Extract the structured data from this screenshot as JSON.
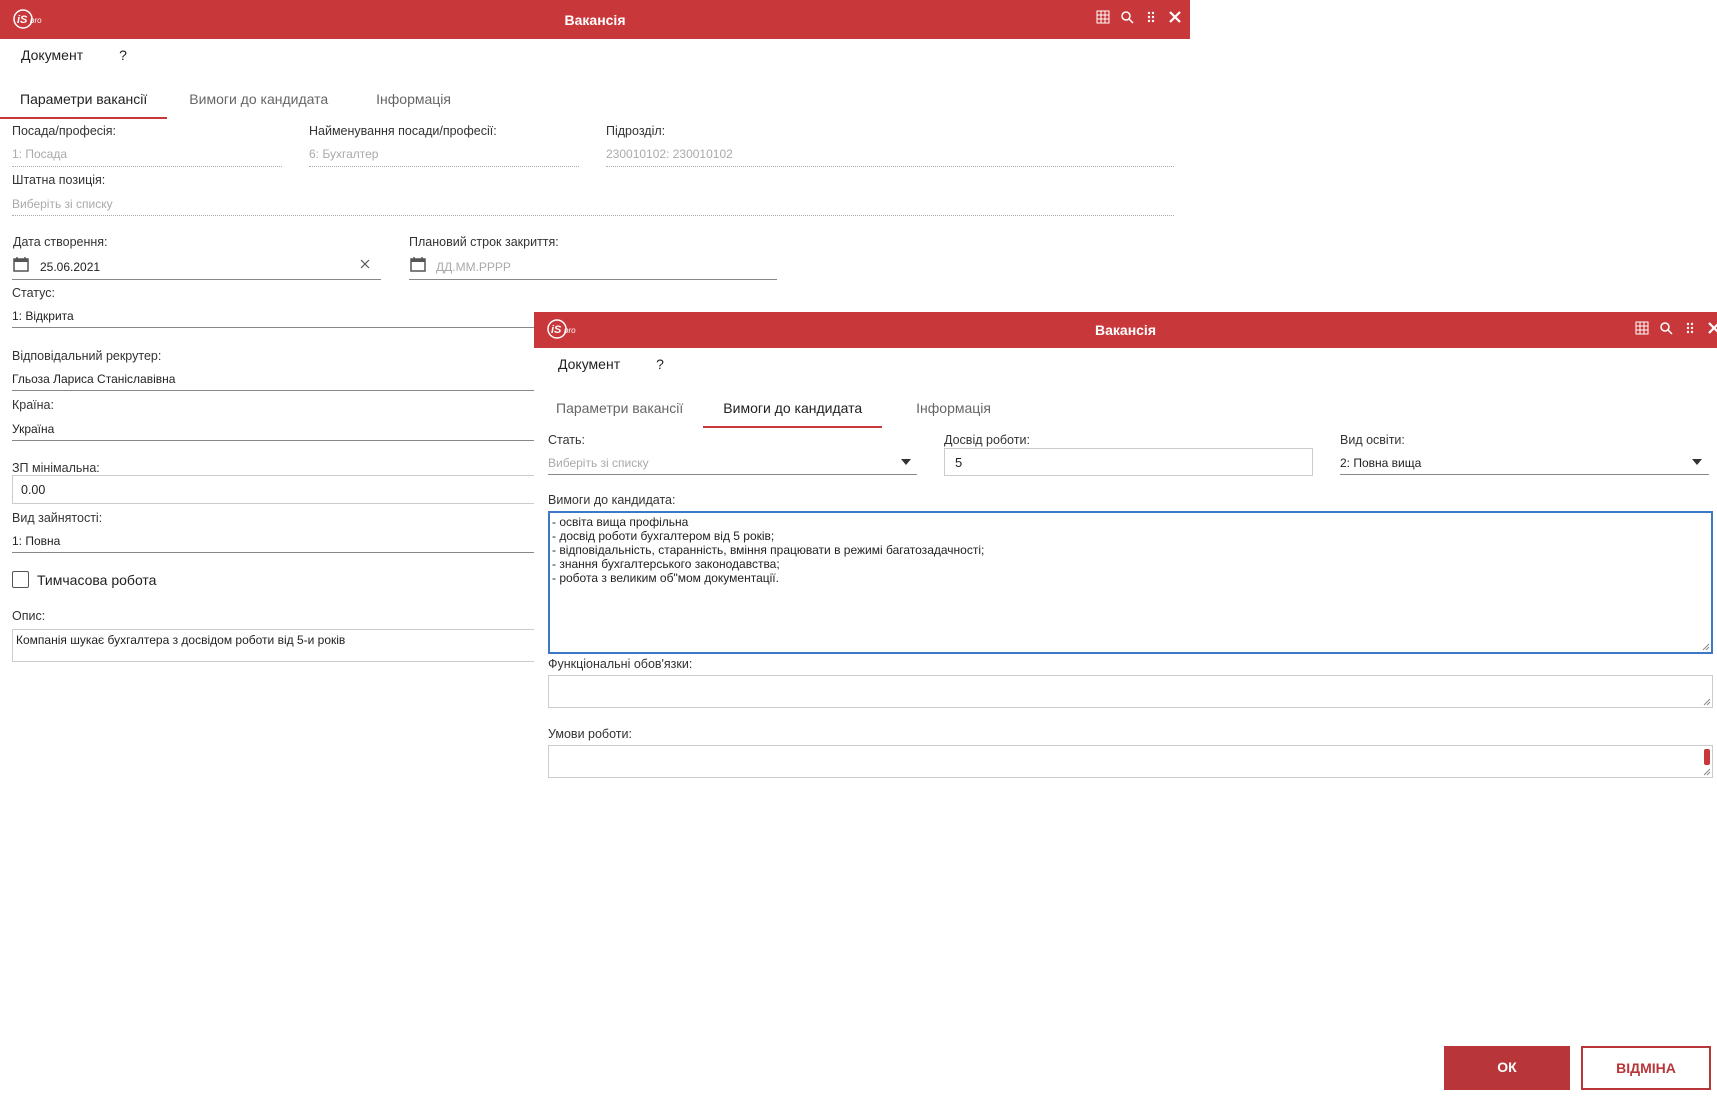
{
  "back_window": {
    "title": "Вакансія",
    "menu": [
      "Документ",
      "?"
    ],
    "tabs": [
      "Параметри вакансії",
      "Вимоги до кандидата",
      "Інформація"
    ],
    "fields": {
      "position_label": "Посада/професія:",
      "position_value": "1: Посада",
      "position_name_label": "Найменування посади/професії:",
      "position_name_value": "6: Бухгалтер",
      "department_label": "Підрозділ:",
      "department_value": "230010102: 230010102",
      "staff_position_label": "Штатна позиція:",
      "staff_position_placeholder": "Виберіть зі списку",
      "created_date_label": "Дата створення:",
      "created_date_value": "25.06.2021",
      "planned_close_label": "Плановий строк закриття:",
      "planned_close_placeholder": "ДД.ММ.РРРР",
      "status_label": "Статус:",
      "status_value": "1: Відкрита",
      "recruiter_label": "Відповідальний рекрутер:",
      "recruiter_value": "Гльоза Лариса Станіславівна",
      "country_label": "Країна:",
      "country_value": "Україна",
      "salary_min_label": "ЗП мінімальна:",
      "salary_min_value": "0.00",
      "employment_type_label": "Вид зайнятості:",
      "employment_type_value": "1: Повна",
      "temporary_work_label": "Тимчасова робота",
      "description_label": "Опис:",
      "description_value": "Компанія шукає бухгалтера з досвідом роботи від 5-и років"
    }
  },
  "front_window": {
    "title": "Вакансія",
    "menu": [
      "Документ",
      "?"
    ],
    "tabs": [
      "Параметри вакансії",
      "Вимоги до кандидата",
      "Інформація"
    ],
    "fields": {
      "gender_label": "Стать:",
      "gender_placeholder": "Виберіть зі списку",
      "experience_label": "Досвід роботи:",
      "experience_value": "5",
      "education_label": "Вид освіти:",
      "education_value": "2: Повна вища",
      "requirements_label": "Вимоги до кандидата:",
      "requirements_lines": [
        "- освіта вища профільна",
        "- досвід роботи бухгалтером від 5 років;",
        "- відповідальність, старанність, вміння працювати в режимі багатозадачності;",
        "- знання бухгалтерського законодавства;",
        "- робота з великим об\"мом документації."
      ],
      "duties_label": "Функціональні обов'язки:",
      "conditions_label": "Умови роботи:"
    },
    "buttons": {
      "ok": "ОК",
      "cancel": "ВІДМІНА"
    }
  },
  "colors": {
    "accent": "#c8373a",
    "focus": "#3d78c7"
  }
}
